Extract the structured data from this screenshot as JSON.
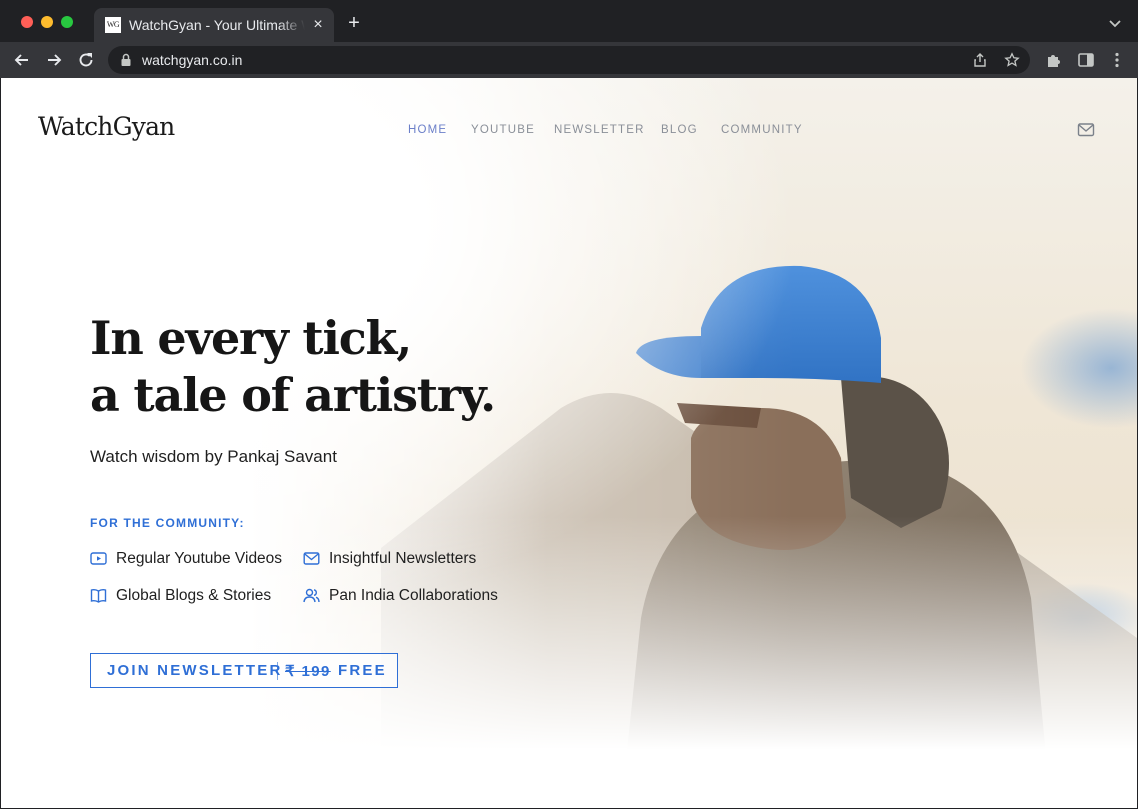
{
  "browser": {
    "tab_title": "WatchGyan - Your Ultimate Watch Guide",
    "tab_favicon": "WG",
    "url": "watchgyan.co.in"
  },
  "site": {
    "logo": "WatchGyan",
    "nav": [
      "HOME",
      "YOUTUBE",
      "NEWSLETTER",
      "BLOG",
      "COMMUNITY"
    ],
    "active_nav": "HOME"
  },
  "hero": {
    "headline_line1": "In every tick,",
    "headline_line2": "a tale of artistry.",
    "subline": "Watch wisdom by Pankaj Savant",
    "community_label": "FOR THE COMMUNITY:",
    "features": [
      {
        "label": "Regular Youtube Videos",
        "icon": "video-icon"
      },
      {
        "label": "Insightful Newsletters",
        "icon": "mail-icon"
      },
      {
        "label": "Global Blogs & Stories",
        "icon": "book-icon"
      },
      {
        "label": "Pan India Collaborations",
        "icon": "users-icon"
      }
    ],
    "cta": {
      "main": "JOIN NEWSLETTER",
      "old_price": "₹ 199",
      "free": "FREE"
    }
  },
  "colors": {
    "accent": "#2f6fd6",
    "nav_active": "#6b7fc9",
    "cap_blue": "#3f86d6"
  }
}
